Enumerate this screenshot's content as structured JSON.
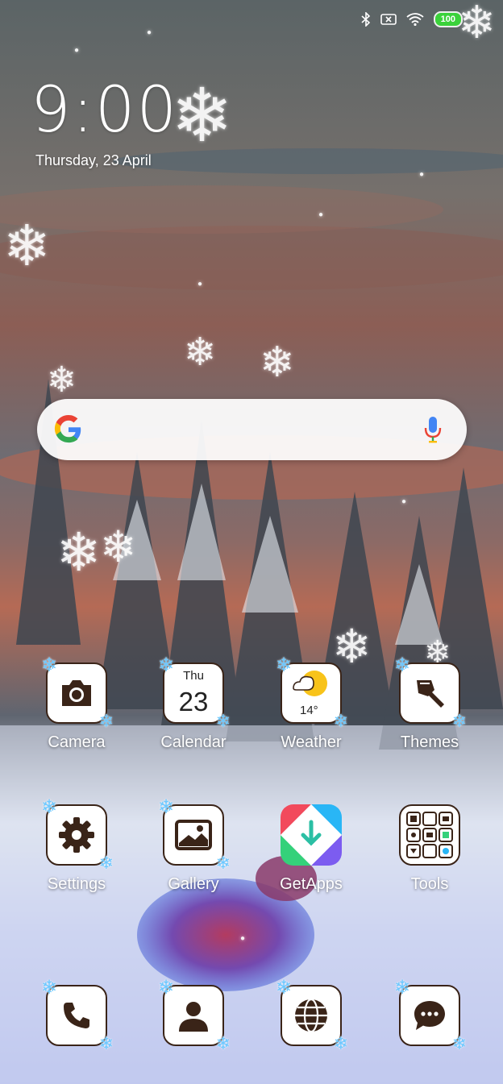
{
  "status_bar": {
    "bluetooth_icon": "bluetooth-icon",
    "sim_icon": "no-sim-icon",
    "wifi_icon": "wifi-icon",
    "battery": "100"
  },
  "clock": {
    "time": "9:00",
    "date": "Thursday, 23 April"
  },
  "search": {
    "logo": "google-g-logo",
    "mic_icon": "microphone-icon"
  },
  "apps": {
    "camera": "Camera",
    "calendar": "Calendar",
    "calendar_day": "Thu",
    "calendar_date": "23",
    "weather": "Weather",
    "weather_temp": "14°",
    "themes": "Themes",
    "settings": "Settings",
    "gallery": "Gallery",
    "getapps": "GetApps",
    "tools": "Tools"
  },
  "dock": {
    "phone_icon": "phone-icon",
    "contacts_icon": "contacts-icon",
    "browser_icon": "globe-icon",
    "messages_icon": "message-icon"
  },
  "colors": {
    "icon_border": "#3a2418",
    "battery_green": "#3bd23b",
    "snowflake_blue": "#6cc8ff"
  }
}
